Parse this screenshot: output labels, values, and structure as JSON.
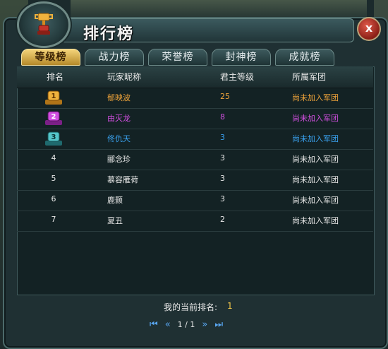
{
  "window": {
    "title": "排行榜",
    "close_label": "x"
  },
  "tabs": [
    {
      "label": "等级榜",
      "active": true
    },
    {
      "label": "战力榜",
      "active": false
    },
    {
      "label": "荣誉榜",
      "active": false
    },
    {
      "label": "封神榜",
      "active": false
    },
    {
      "label": "成就榜",
      "active": false
    }
  ],
  "table": {
    "headers": [
      "排名",
      "玩家昵称",
      "君主等级",
      "所属军团"
    ],
    "rows": [
      {
        "rank": "1",
        "name": "郁映波",
        "level": "25",
        "guild": "尚未加入军团",
        "color": "#f0a43a"
      },
      {
        "rank": "2",
        "name": "由灭龙",
        "level": "8",
        "guild": "尚未加入军团",
        "color": "#d24fe0"
      },
      {
        "rank": "3",
        "name": "佟仇天",
        "level": "3",
        "guild": "尚未加入军团",
        "color": "#3aa2f0"
      },
      {
        "rank": "4",
        "name": "郦念珍",
        "level": "3",
        "guild": "尚未加入军团",
        "color": "#e8e8e8"
      },
      {
        "rank": "5",
        "name": "慕容雁荷",
        "level": "3",
        "guild": "尚未加入军团",
        "color": "#e8e8e8"
      },
      {
        "rank": "6",
        "name": "鹿颢",
        "level": "3",
        "guild": "尚未加入军团",
        "color": "#e8e8e8"
      },
      {
        "rank": "7",
        "name": "夏丑",
        "level": "2",
        "guild": "尚未加入军团",
        "color": "#e8e8e8"
      }
    ]
  },
  "footer": {
    "my_rank_label": "我的当前排名:",
    "my_rank_value": "1",
    "page_text": "1 / 1",
    "first_icon": "first-page-icon",
    "prev_icon": "prev-page-icon",
    "next_icon": "next-page-icon",
    "last_icon": "last-page-icon"
  },
  "colors": {
    "medal_gold": "#f0a43a",
    "medal_purple": "#d24fe0",
    "medal_teal": "#3aa2f0"
  }
}
